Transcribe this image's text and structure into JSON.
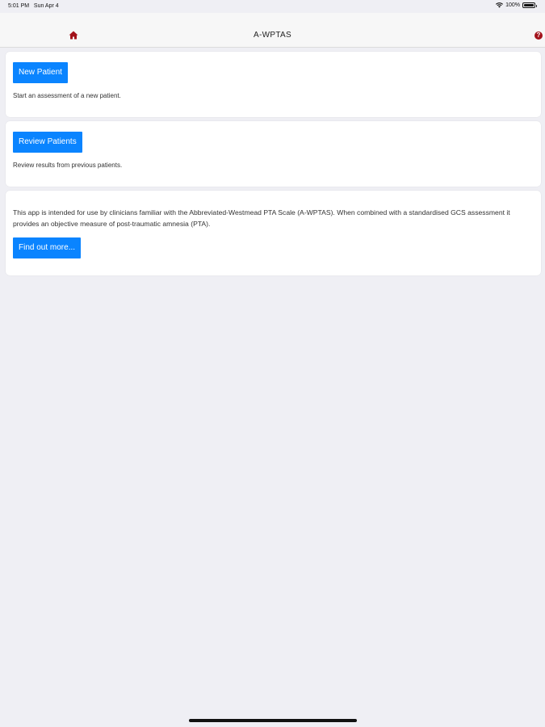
{
  "status_bar": {
    "time": "5:01 PM",
    "date": "Sun Apr 4",
    "battery": "100%",
    "battery_level": 1.0,
    "wifi_icon": "wifi-icon",
    "battery_icon": "battery-icon"
  },
  "nav": {
    "title": "A-WPTAS",
    "home_icon": "home-icon",
    "help_icon": "help-icon",
    "help_glyph": "?",
    "accent_color": "#a3121b"
  },
  "new_patient": {
    "button_label": "New Patient",
    "description": "Start an assessment of a new patient."
  },
  "review_patients": {
    "button_label": "Review Patients",
    "description": "Review results from previous patients."
  },
  "info": {
    "text": "This app is intended for use by clinicians familiar with the Abbreviated-Westmead PTA Scale (A-WPTAS). When combined with a standardised GCS assessment it provides an objective measure of post-traumatic amnesia (PTA).",
    "button_label": "Find out more..."
  },
  "colors": {
    "button": "#0a84ff",
    "background": "#efeff4"
  }
}
